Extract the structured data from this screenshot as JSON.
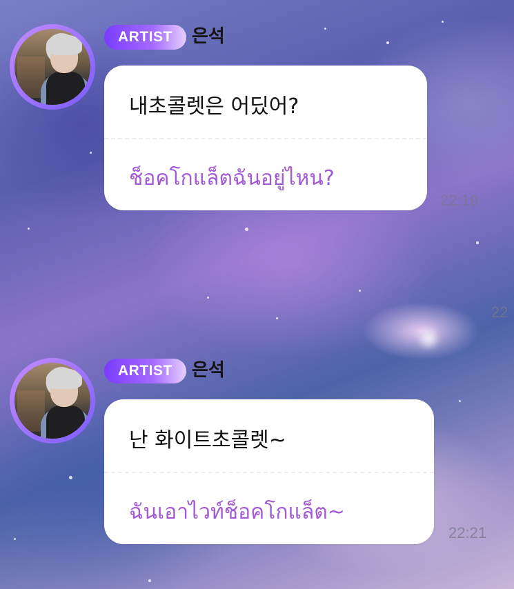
{
  "messages": [
    {
      "badge": "ARTIST",
      "sender": "은석",
      "original": "내초콜렛은 어딨어?",
      "translation": "ช็อคโกแล็ตฉันอยู่ไหน?",
      "time": "22:19"
    },
    {
      "badge": "ARTIST",
      "sender": "은석",
      "original": "난 화이트초콜렛~",
      "translation": "ฉันเอาไวท์ช็อคโกแล็ต~",
      "time": "22:21"
    }
  ],
  "partial_time": "22"
}
